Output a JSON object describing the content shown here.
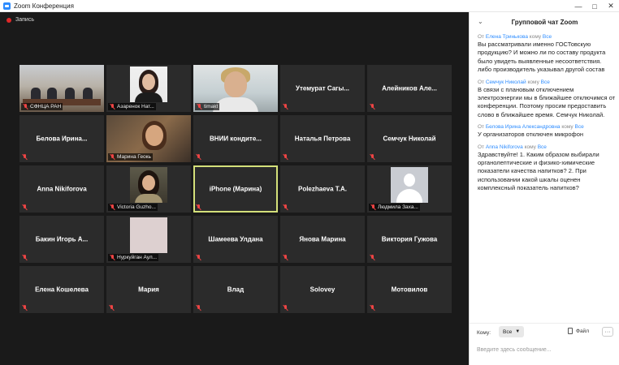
{
  "window": {
    "title": "Zoom Конференция"
  },
  "recording": {
    "label": "Запись"
  },
  "participants": [
    {
      "name": "СФНЦА РАН",
      "video": "room"
    },
    {
      "name": "Азаренок Нат...",
      "video": "avatar-portrait"
    },
    {
      "name": "timakt",
      "video": "office"
    },
    {
      "name": "Утемурат Сагы...",
      "video": "none"
    },
    {
      "name": "Алейников Але...",
      "video": "none"
    },
    {
      "name": "Белова Ирина...",
      "video": "none"
    },
    {
      "name": "Марина Геокь",
      "video": "home"
    },
    {
      "name": "ВНИИ кондите...",
      "video": "none"
    },
    {
      "name": "Наталья Петрова",
      "video": "none"
    },
    {
      "name": "Семчук Николай",
      "video": "none"
    },
    {
      "name": "Anna Nikiforova",
      "video": "none"
    },
    {
      "name": "Victoria Guzho...",
      "video": "avatar-portrait2"
    },
    {
      "name": "iPhone (Марина)",
      "video": "none",
      "active": true
    },
    {
      "name": "Polezhaeva T.A.",
      "video": "none"
    },
    {
      "name": "Людмила Заха...",
      "video": "avatar-default"
    },
    {
      "name": "Бакин Игорь А...",
      "video": "none"
    },
    {
      "name": "Нуркуйган Аул...",
      "video": "avatar-blank"
    },
    {
      "name": "Шамеева Улдана",
      "video": "none"
    },
    {
      "name": "Янова Марина",
      "video": "none"
    },
    {
      "name": "Виктория Гужова",
      "video": "none"
    },
    {
      "name": "Елена Кошелева",
      "video": "none"
    },
    {
      "name": "Мария",
      "video": "none"
    },
    {
      "name": "Влад",
      "video": "none"
    },
    {
      "name": "Solovey",
      "video": "none"
    },
    {
      "name": "Мотовилов",
      "video": "none"
    }
  ],
  "chat": {
    "title": "Групповой чат Zoom",
    "messages": [
      {
        "prefix": "От",
        "from": "Елена Тринькова",
        "mid": "кому",
        "to": "Все",
        "text": "Вы рассматривали именно ГОСТовскую продукцию? И можно ли по составу продукта было увидеть выявленные несоответствия. либо производитель указывал другой состав"
      },
      {
        "prefix": "От",
        "from": "Семчук Николай",
        "mid": "кому",
        "to": "Все",
        "text": "В связи с плановым отключением электроэнергии мы в ближайшее отключимся от конференции. Поэтому просим предоставить слово в ближайшее время. Семчук Николай."
      },
      {
        "prefix": "От",
        "from": "Белова Ирина Александровна",
        "mid": "кому",
        "to": "Все",
        "text": "У организаторов отключен микрофон"
      },
      {
        "prefix": "От",
        "from": "Anna Nikiforova",
        "mid": "кому",
        "to": "Все",
        "text": "Здравствуйте! 1. Каким образом выбирали органолептические и физико-химические показатели качества напитков? 2. При использовании какой шкалы оценен комплексный показатель напитков?"
      }
    ],
    "compose": {
      "to_label": "Кому:",
      "to_value": "Все",
      "file_label": "Файл",
      "more_label": "···",
      "placeholder": "Введите здесь сообщение..."
    }
  }
}
